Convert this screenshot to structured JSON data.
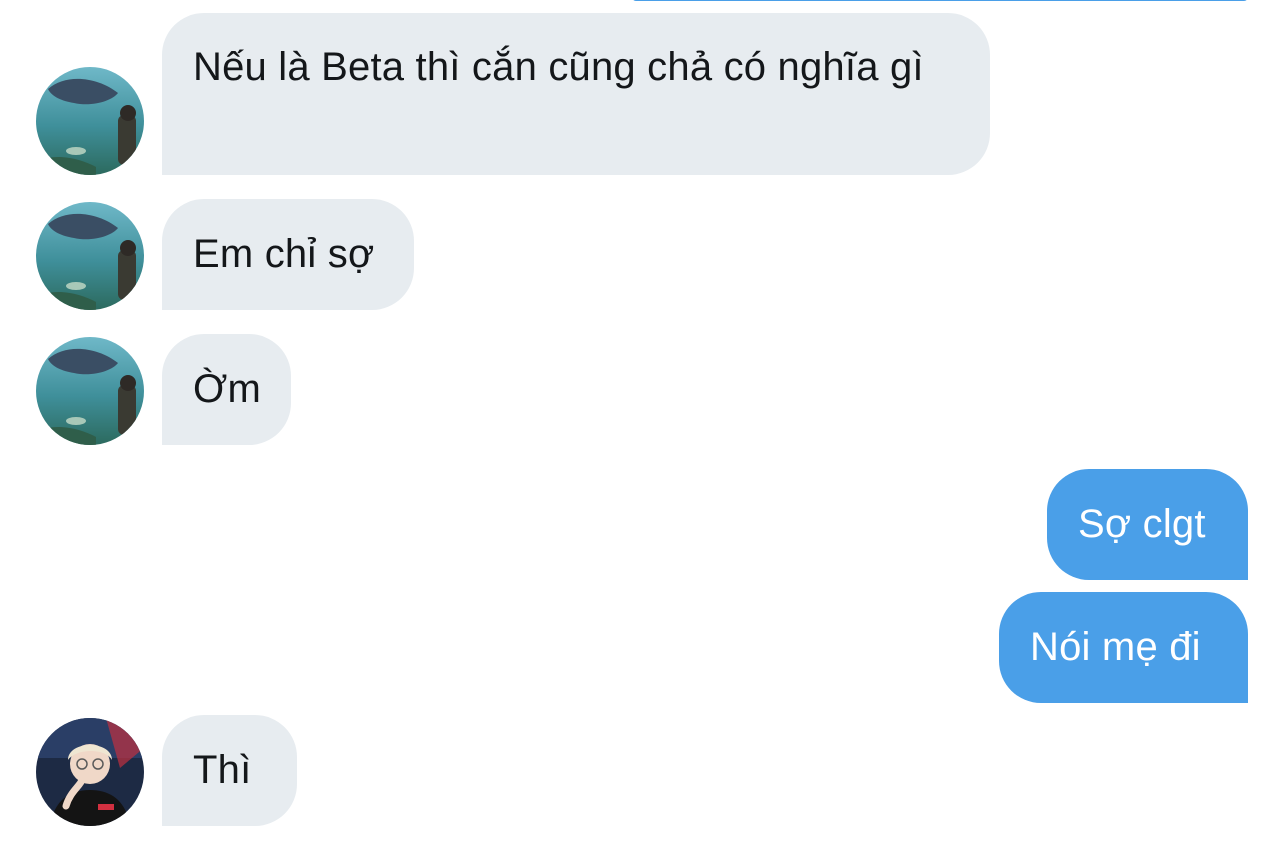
{
  "conversation": {
    "messages": [
      {
        "side": "incoming",
        "text": "Nếu là Beta thì cắn cũng chả có nghĩa gì"
      },
      {
        "side": "incoming",
        "text": "Em chỉ sợ"
      },
      {
        "side": "incoming",
        "text": "Ờm"
      },
      {
        "side": "outgoing",
        "text": "Sợ clgt"
      },
      {
        "side": "outgoing",
        "text": "Nói mẹ đi"
      },
      {
        "side": "incoming",
        "text": "Thì"
      }
    ]
  },
  "colors": {
    "incoming_bubble": "#e7ecf0",
    "outgoing_bubble": "#4a9fe8",
    "incoming_text": "#14171a",
    "outgoing_text": "#ffffff"
  },
  "avatars": {
    "aquarium": "aquarium-avatar-icon",
    "person": "person-avatar-icon"
  }
}
